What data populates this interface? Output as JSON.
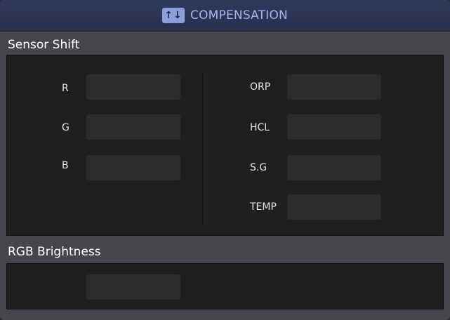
{
  "header": {
    "title": "COMPENSATION",
    "icon": "swap-arrows-icon"
  },
  "sensor_shift": {
    "title": "Sensor Shift",
    "left_fields": [
      {
        "label": "R",
        "value": ""
      },
      {
        "label": "G",
        "value": ""
      },
      {
        "label": "B",
        "value": ""
      }
    ],
    "right_fields": [
      {
        "label": "ORP",
        "value": ""
      },
      {
        "label": "HCL",
        "value": ""
      },
      {
        "label": "S.G",
        "value": ""
      },
      {
        "label": "TEMP",
        "value": ""
      }
    ]
  },
  "rgb_brightness": {
    "title": "RGB Brightness",
    "value": ""
  },
  "colors": {
    "header_bg": "#2b3453",
    "accent": "#8f9dda",
    "panel_bg": "#1f1f1f",
    "field_bg": "#2b2c2c"
  }
}
